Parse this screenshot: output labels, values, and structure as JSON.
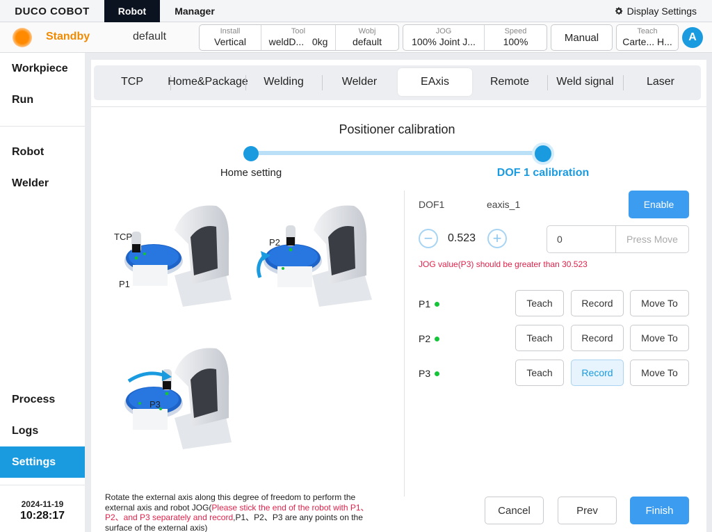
{
  "topbar": {
    "logo": "DUCO COBOT",
    "tabs": [
      "Robot",
      "Manager"
    ],
    "display_settings": "Display Settings"
  },
  "status": {
    "state": "Standby",
    "profile": "default",
    "install": {
      "label": "Install",
      "value": "Vertical"
    },
    "tool": {
      "label": "Tool",
      "value": "weldD...",
      "weight": "0kg"
    },
    "wobj": {
      "label": "Wobj",
      "value": "default"
    },
    "jog": {
      "label": "JOG",
      "value": "100% Joint J..."
    },
    "speed": {
      "label": "Speed",
      "value": "100%"
    },
    "mode": "Manual",
    "teach": {
      "label": "Teach",
      "value": "Carte... H..."
    },
    "user_initial": "A"
  },
  "sidebar": {
    "items": [
      "Workpiece",
      "Run",
      "Robot",
      "Welder",
      "Process",
      "Logs",
      "Settings"
    ],
    "active": "Settings",
    "date": "2024-11-19",
    "time": "10:28:17"
  },
  "settings_tabs": [
    "TCP",
    "Home&Package",
    "Welding",
    "Welder",
    "EAxis",
    "Remote",
    "Weld signal",
    "Laser"
  ],
  "active_tab": "EAxis",
  "calibration": {
    "title": "Positioner calibration",
    "steps": [
      "Home setting",
      "DOF 1 calibration"
    ],
    "active_step": 2,
    "illustration_labels": {
      "tcp": "TCP",
      "p1": "P1",
      "p2": "P2",
      "p3": "P3"
    },
    "instruction_plain": "Rotate the external axis along this degree of freedom to perform the external axis and robot JOG(",
    "instruction_warn": "Please stick the end of the robot with P1、P2、and P3 separately and record",
    "instruction_tail": ",P1、P2、P3 are any points on the surface of the external axis)",
    "dof_label": "DOF1",
    "axis_name": "eaxis_1",
    "enable_label": "Enable",
    "dof_value": "0.523",
    "press_value": "0",
    "press_move_label": "Press Move",
    "jog_warning": "JOG value(P3) should be greater than 30.523",
    "points": [
      {
        "name": "P1",
        "teach": "Teach",
        "record": "Record",
        "move": "Move To"
      },
      {
        "name": "P2",
        "teach": "Teach",
        "record": "Record",
        "move": "Move To"
      },
      {
        "name": "P3",
        "teach": "Teach",
        "record": "Record",
        "move": "Move To"
      }
    ],
    "cancel_label": "Cancel",
    "prev_label": "Prev",
    "finish_label": "Finish"
  },
  "colors": {
    "accent": "#1a9be0",
    "standby": "#f08a00",
    "warning": "#e0224a",
    "point_ok": "#16c43a"
  }
}
